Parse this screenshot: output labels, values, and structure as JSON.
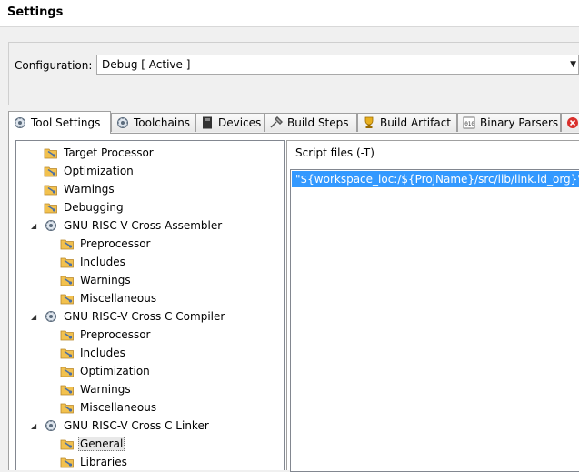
{
  "header": {
    "title": "Settings"
  },
  "configuration": {
    "label": "Configuration:",
    "value": "Debug  [ Active ]"
  },
  "tabs": [
    {
      "label": "Tool Settings",
      "icon": "tool-settings-icon",
      "active": true
    },
    {
      "label": "Toolchains",
      "icon": "toolchains-icon"
    },
    {
      "label": "Devices",
      "icon": "devices-icon"
    },
    {
      "label": "Build Steps",
      "icon": "build-steps-icon"
    },
    {
      "label": "Build Artifact",
      "icon": "build-artifact-icon"
    },
    {
      "label": "Binary Parsers",
      "icon": "binary-parsers-icon"
    },
    {
      "label": "",
      "icon": "error-parsers-icon"
    }
  ],
  "tree": [
    {
      "label": "Target Processor",
      "level": 1,
      "type": "option"
    },
    {
      "label": "Optimization",
      "level": 1,
      "type": "option"
    },
    {
      "label": "Warnings",
      "level": 1,
      "type": "option"
    },
    {
      "label": "Debugging",
      "level": 1,
      "type": "option"
    },
    {
      "label": "GNU RISC-V Cross Assembler",
      "level": 0,
      "type": "tool",
      "expanded": true
    },
    {
      "label": "Preprocessor",
      "level": 2,
      "type": "option"
    },
    {
      "label": "Includes",
      "level": 2,
      "type": "option"
    },
    {
      "label": "Warnings",
      "level": 2,
      "type": "option"
    },
    {
      "label": "Miscellaneous",
      "level": 2,
      "type": "option"
    },
    {
      "label": "GNU RISC-V Cross C Compiler",
      "level": 0,
      "type": "tool",
      "expanded": true
    },
    {
      "label": "Preprocessor",
      "level": 2,
      "type": "option"
    },
    {
      "label": "Includes",
      "level": 2,
      "type": "option"
    },
    {
      "label": "Optimization",
      "level": 2,
      "type": "option"
    },
    {
      "label": "Warnings",
      "level": 2,
      "type": "option"
    },
    {
      "label": "Miscellaneous",
      "level": 2,
      "type": "option"
    },
    {
      "label": "GNU RISC-V Cross C Linker",
      "level": 0,
      "type": "tool",
      "expanded": true
    },
    {
      "label": "General",
      "level": 2,
      "type": "option",
      "selected": true
    },
    {
      "label": "Libraries",
      "level": 2,
      "type": "option"
    }
  ],
  "script_files": {
    "title": "Script files (-T)",
    "items": [
      "\"${workspace_loc:/${ProjName}/src/lib/link.ld_org}\""
    ]
  },
  "colors": {
    "selection": "#3399ff",
    "folder": "#f2c14e"
  }
}
